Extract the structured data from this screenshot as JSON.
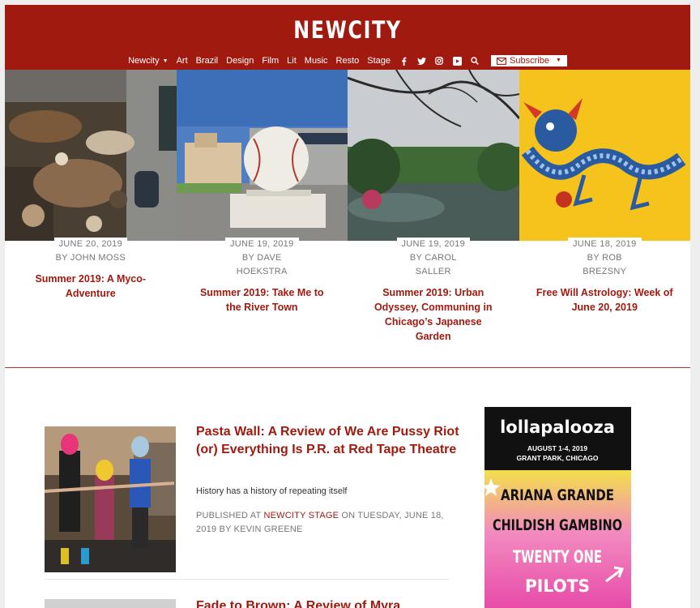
{
  "site": {
    "logo": "NEWCITY"
  },
  "nav": {
    "items": [
      "Newcity",
      "Art",
      "Brazil",
      "Design",
      "Film",
      "Lit",
      "Music",
      "Resto",
      "Stage"
    ],
    "social_icons": [
      "facebook-icon",
      "twitter-icon",
      "instagram-icon",
      "youtube-icon",
      "search-icon"
    ],
    "subscribe_label": "Subscribe"
  },
  "featured": [
    {
      "date": "JUNE 20, 2019",
      "byline": "BY JOHN MOSS",
      "title": "Summer 2019: A Myco-Adventure",
      "image": "mushrooms-table-photo"
    },
    {
      "date": "JUNE 19, 2019",
      "byline": "BY DAVE HOEKSTRA",
      "title": "Summer 2019: Take Me to the River Town",
      "image": "baseball-statue-photo"
    },
    {
      "date": "JUNE 19, 2019",
      "byline": "BY CAROL SALLER",
      "title": "Summer 2019: Urban Odyssey, Communing in Chicago’s Japanese Garden",
      "image": "japanese-garden-photo"
    },
    {
      "date": "JUNE 18, 2019",
      "byline": "BY ROB BREZSNY",
      "title": "Free Will Astrology: Week of June 20, 2019",
      "image": "chinese-dragon-flag"
    }
  ],
  "articles": [
    {
      "title": "Pasta Wall: A Review of We Are Pussy Riot (or) Everything Is P.R. at Red Tape Theatre",
      "dek": "History has a history of repeating itself",
      "meta_prefix": "PUBLISHED AT ",
      "section": "NEWCITY STAGE",
      "meta_suffix": " ON TUESDAY, JUNE 18, 2019  BY KEVIN GREENE"
    },
    {
      "title": "Fade to Brown: A Review of Myra"
    }
  ],
  "ad": {
    "brand": "lollapalooza",
    "dates": "AUGUST 1-4, 2019",
    "location": "GRANT PARK, CHICAGO",
    "lineup": [
      "ARIANA GRANDE",
      "CHILDISH GAMBINO",
      "TWENTY ONE",
      "PILOTS"
    ]
  },
  "colors": {
    "brand": "#a01a10",
    "meta_gray": "#777777"
  }
}
